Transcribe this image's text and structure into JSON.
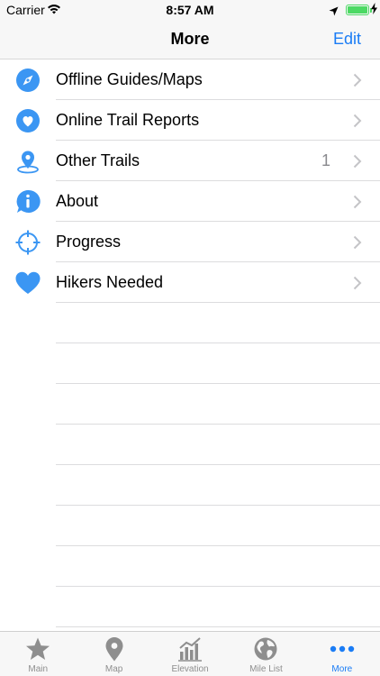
{
  "status_bar": {
    "carrier": "Carrier",
    "time": "8:57 AM",
    "battery_level": 1.0
  },
  "nav": {
    "title": "More",
    "edit_label": "Edit"
  },
  "menu": [
    {
      "label": "Offline Guides/Maps",
      "icon": "compass-icon",
      "badge": ""
    },
    {
      "label": "Online Trail Reports",
      "icon": "heart-badge-icon",
      "badge": ""
    },
    {
      "label": "Other Trails",
      "icon": "map-pin-icon",
      "badge": "1"
    },
    {
      "label": "About",
      "icon": "info-bubble-icon",
      "badge": ""
    },
    {
      "label": "Progress",
      "icon": "crosshair-icon",
      "badge": ""
    },
    {
      "label": "Hikers Needed",
      "icon": "heart-icon",
      "badge": ""
    }
  ],
  "tabs": [
    {
      "label": "Main",
      "icon": "star-icon",
      "active": false
    },
    {
      "label": "Map",
      "icon": "map-pin-icon",
      "active": false
    },
    {
      "label": "Elevation",
      "icon": "chart-icon",
      "active": false
    },
    {
      "label": "Mile List",
      "icon": "globe-icon",
      "active": false
    },
    {
      "label": "More",
      "icon": "more-dots-icon",
      "active": true
    }
  ],
  "colors": {
    "accent": "#1a7cf5",
    "icon_blue": "#3b96f3",
    "inactive": "#8e8e8e",
    "battery": "#4cd964"
  }
}
